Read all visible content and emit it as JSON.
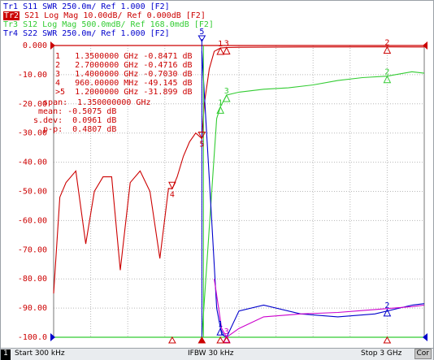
{
  "traces": [
    {
      "id": "Tr1",
      "text": "Tr1 S11 SWR 250.0m/ Ref 1.000 [F2]",
      "color": "#0000cc",
      "active": false
    },
    {
      "id": "Tr2",
      "text": " S21 Log Mag 10.00dB/ Ref 0.000dB [F2]",
      "tag": "Tr2",
      "color": "#cc0000",
      "active": true
    },
    {
      "id": "Tr3",
      "text": "Tr3 S12 Log Mag 500.0mdB/ Ref 168.0mdB [F2]",
      "color": "#33cc33",
      "active": false
    },
    {
      "id": "Tr4",
      "text": "Tr4 S22 SWR 250.0m/ Ref 1.000 [F2]",
      "color": "#0000cc",
      "active": false
    }
  ],
  "y_axis": [
    "0.000",
    "-10.00",
    "-20.00",
    "-30.00",
    "-40.00",
    "-50.00",
    "-60.00",
    "-70.00",
    "-80.00",
    "-90.00",
    "-100.0"
  ],
  "markers_table": [
    "1   1.3500000 GHz -0.8471 dB",
    "2   2.7000000 GHz -0.4716 dB",
    "3   1.4000000 GHz -0.7030 dB",
    "4   960.00000 MHz -49.145 dB",
    ">5  1.2000000 GHz -31.899 dB"
  ],
  "stats": [
    "  span:  1.350000000 GHz",
    " mean: -0.5075 dB",
    "s.dev:  0.0961 dB",
    "  p-p:  0.4807 dB"
  ],
  "marker_labels": {
    "m1": "1",
    "m2": "2",
    "m3": "3",
    "m4": "4",
    "m5": "5"
  },
  "status": {
    "channel": "1",
    "start": "Start 300 kHz",
    "ifbw": "IFBW 30 kHz",
    "stop": "Stop 3 GHz",
    "cor": "Cor"
  },
  "chart_data": {
    "type": "line",
    "xlabel": "",
    "ylabel": "",
    "x_range_ghz": [
      0.0003,
      3.0
    ],
    "ylim": [
      -100,
      0
    ],
    "series": [
      {
        "name": "S21",
        "color": "#cc0000",
        "x": [
          0.0003,
          0.05,
          0.1,
          0.18,
          0.26,
          0.33,
          0.4,
          0.47,
          0.54,
          0.62,
          0.7,
          0.78,
          0.86,
          0.93,
          0.96,
          1.0,
          1.05,
          1.1,
          1.15,
          1.2,
          1.22,
          1.26,
          1.3,
          1.35,
          1.4,
          1.5,
          2.0,
          2.7,
          3.0
        ],
        "y": [
          -85,
          -52,
          -47,
          -43,
          -68,
          -50,
          -45,
          -45,
          -77,
          -47,
          -43,
          -50,
          -73,
          -49,
          -49.1,
          -45,
          -38,
          -33,
          -30,
          -31.9,
          -20,
          -8,
          -2,
          -0.85,
          -0.7,
          -0.6,
          -0.5,
          -0.47,
          -0.5
        ]
      },
      {
        "name": "S12",
        "color": "#33cc33",
        "x": [
          1.2,
          1.32,
          1.35,
          1.4,
          1.5,
          1.7,
          1.9,
          2.1,
          2.3,
          2.5,
          2.7,
          2.9,
          3.0
        ],
        "y": [
          -100,
          -25,
          -21,
          -17,
          -16,
          -15,
          -14.5,
          -13.5,
          -12,
          -11,
          -10.5,
          -9,
          -9.5
        ]
      },
      {
        "name": "S11",
        "color": "#0000cc",
        "x": [
          1.2,
          1.28,
          1.32,
          1.36,
          1.4,
          1.5,
          1.7,
          2.0,
          2.3,
          2.6,
          2.9,
          3.0
        ],
        "y": [
          -2,
          -60,
          -90,
          -99,
          -100,
          -91,
          -89,
          -92,
          -93,
          -92,
          -89,
          -88.5
        ]
      },
      {
        "name": "S22",
        "color": "#cc00cc",
        "x": [
          1.3,
          1.36,
          1.4,
          1.5,
          1.7,
          2.0,
          2.3,
          2.6,
          2.9,
          3.0
        ],
        "y": [
          -80,
          -97,
          -100,
          -97,
          -93,
          -92,
          -91.5,
          -90.5,
          -89.5,
          -89
        ]
      }
    ]
  }
}
